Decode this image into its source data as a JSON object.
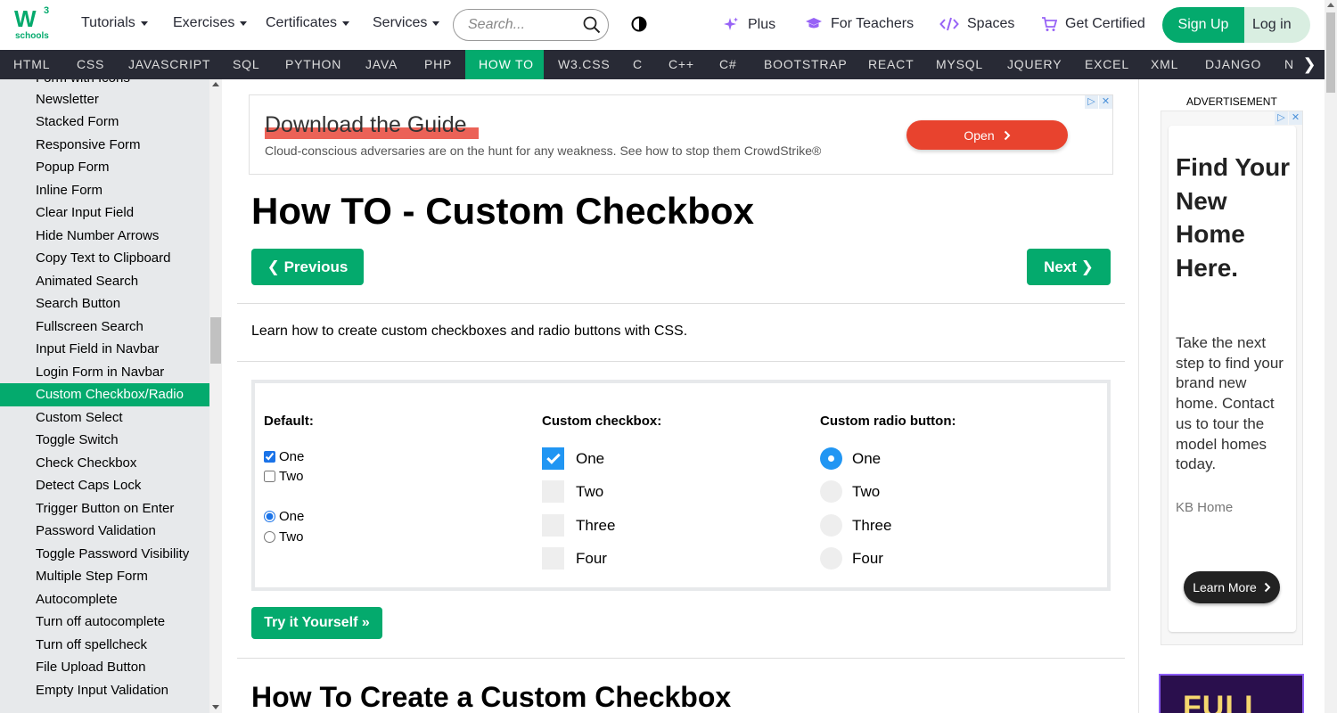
{
  "logo": {
    "mark": "W",
    "superscript": "3",
    "sub": "schools"
  },
  "top_menu": [
    {
      "label": "Tutorials"
    },
    {
      "label": "Exercises"
    },
    {
      "label": "Certificates"
    },
    {
      "label": "Services"
    }
  ],
  "search": {
    "placeholder": "Search..."
  },
  "top_links": {
    "plus": "Plus",
    "teachers": "For Teachers",
    "spaces": "Spaces",
    "certified": "Get Certified"
  },
  "auth": {
    "signup": "Sign Up",
    "login": "Log in"
  },
  "nav": [
    "HTML",
    "CSS",
    "JAVASCRIPT",
    "SQL",
    "PYTHON",
    "JAVA",
    "PHP",
    "HOW TO",
    "W3.CSS",
    "C",
    "C++",
    "C#",
    "BOOTSTRAP",
    "REACT",
    "MYSQL",
    "JQUERY",
    "EXCEL",
    "XML",
    "DJANGO",
    "N"
  ],
  "nav_active": "HOW TO",
  "nav_more": "❯",
  "sidebar": {
    "items": [
      "Form with Icons",
      "Newsletter",
      "Stacked Form",
      "Responsive Form",
      "Popup Form",
      "Inline Form",
      "Clear Input Field",
      "Hide Number Arrows",
      "Copy Text to Clipboard",
      "Animated Search",
      "Search Button",
      "Fullscreen Search",
      "Input Field in Navbar",
      "Login Form in Navbar",
      "Custom Checkbox/Radio",
      "Custom Select",
      "Toggle Switch",
      "Check Checkbox",
      "Detect Caps Lock",
      "Trigger Button on Enter",
      "Password Validation",
      "Toggle Password Visibility",
      "Multiple Step Form",
      "Autocomplete",
      "Turn off autocomplete",
      "Turn off spellcheck",
      "File Upload Button",
      "Empty Input Validation"
    ],
    "active": "Custom Checkbox/Radio"
  },
  "ad_banner": {
    "headline": "Download the Guide",
    "body": "Cloud-conscious adversaries are on the hunt for any weakness. See how to stop them CrowdStrike®",
    "cta": "Open"
  },
  "page": {
    "title": "How TO - Custom Checkbox",
    "prev": "❮ Previous",
    "next": "Next ❯",
    "intro": "Learn how to create custom checkboxes and radio buttons with CSS.",
    "try_it": "Try it Yourself »",
    "section_heading": "How To Create a Custom Checkbox"
  },
  "example": {
    "default_heading": "Default:",
    "default_checkboxes": [
      {
        "label": "One",
        "checked": true
      },
      {
        "label": "Two",
        "checked": false
      }
    ],
    "default_radios": [
      {
        "label": "One",
        "checked": true
      },
      {
        "label": "Two",
        "checked": false
      }
    ],
    "custom_checkbox_heading": "Custom checkbox:",
    "custom_checkboxes": [
      {
        "label": "One",
        "checked": true
      },
      {
        "label": "Two",
        "checked": false
      },
      {
        "label": "Three",
        "checked": false
      },
      {
        "label": "Four",
        "checked": false
      }
    ],
    "custom_radio_heading": "Custom radio button:",
    "custom_radios": [
      {
        "label": "One",
        "checked": true
      },
      {
        "label": "Two",
        "checked": false
      },
      {
        "label": "Three",
        "checked": false
      },
      {
        "label": "Four",
        "checked": false
      }
    ]
  },
  "side_ad": {
    "label": "ADVERTISEMENT",
    "headline": "Find Your New Home Here.",
    "body": "Take the next step to find your brand new home. Contact us to tour the model homes today.",
    "brand": "KB Home",
    "cta": "Learn More",
    "promo": "FULL"
  },
  "colors": {
    "brand_green": "#04AA6D",
    "nav_bg": "#282A35",
    "sidebar_bg": "#E7E9EB",
    "custom_checked": "#2196F3"
  }
}
